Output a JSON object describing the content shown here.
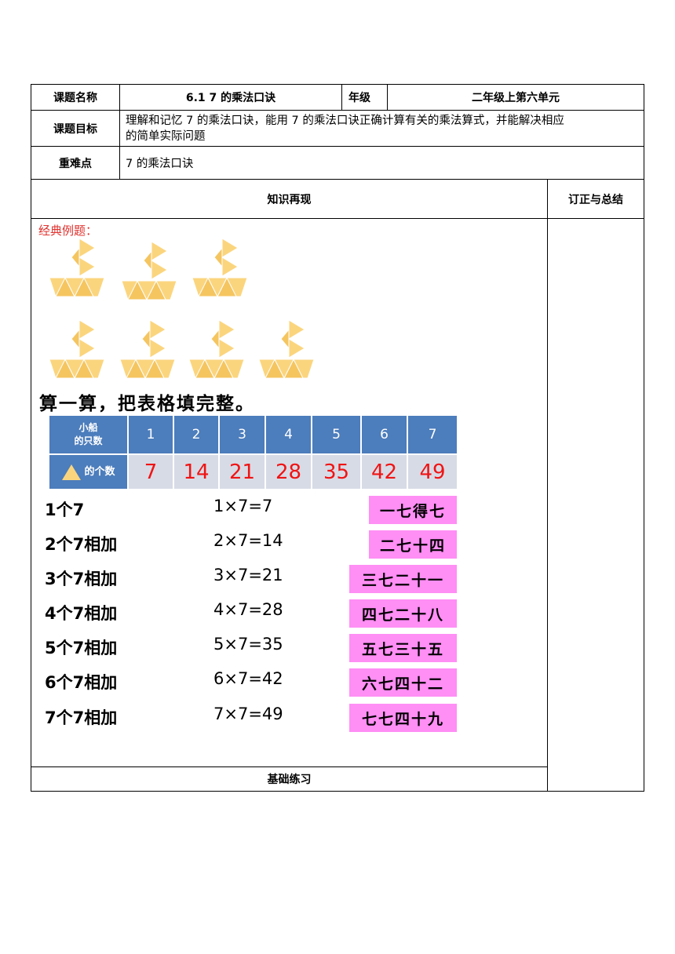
{
  "header": {
    "topic_label": "课题名称",
    "topic_value": "6.1  7 的乘法口诀",
    "grade_label": "年级",
    "grade_value": "二年级上第六单元",
    "goal_label": "课题目标",
    "goal_value_line1": "理解和记忆 7 的乘法口诀，能用 7 的乘法口诀正确计算有关的乘法算式，并能解决相应",
    "goal_value_line2": "的简单实际问题",
    "key_label": "重难点",
    "key_value": "7 的乘法口诀"
  },
  "sections": {
    "knowledge": "知识再现",
    "correction": "订正与总结",
    "example_title": "经典例题：",
    "task": "算一算，把表格填完整。",
    "basic_practice": "基础练习"
  },
  "table": {
    "row1_label_line1": "小船",
    "row1_label_line2": "的只数",
    "row2_label": "的个数",
    "boats": [
      "1",
      "2",
      "3",
      "4",
      "5",
      "6",
      "7"
    ],
    "triangles": [
      "7",
      "14",
      "21",
      "28",
      "35",
      "42",
      "49"
    ]
  },
  "rows": [
    {
      "phrase": "1个7",
      "equation": "1×7=7",
      "koujue": "一七得七"
    },
    {
      "phrase": "2个7相加",
      "equation": "2×7=14",
      "koujue": "二七十四"
    },
    {
      "phrase": "3个7相加",
      "equation": "3×7=21",
      "koujue": "三七二十一"
    },
    {
      "phrase": "4个7相加",
      "equation": "4×7=28",
      "koujue": "四七二十八"
    },
    {
      "phrase": "5个7相加",
      "equation": "5×7=35",
      "koujue": "五七三十五"
    },
    {
      "phrase": "6个7相加",
      "equation": "6×7=42",
      "koujue": "六七四十二"
    },
    {
      "phrase": "7个7相加",
      "equation": "7×7=49",
      "koujue": "七七四十九"
    }
  ],
  "colors": {
    "accent": "#4c7dbc",
    "value_bg": "#d7dbe6",
    "koujue_bg": "#ff8ef5",
    "boat": "#fbd57e"
  }
}
